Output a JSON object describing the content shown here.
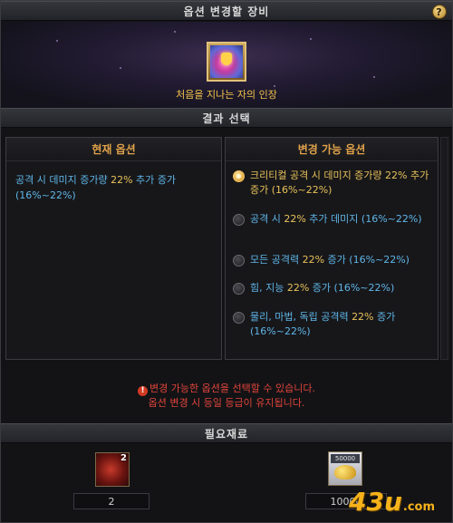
{
  "window": {
    "title": "옵션 변경할 장비",
    "help_label": "?"
  },
  "equipment": {
    "icon": "ring-equipment-icon",
    "name": "처음을 지나는 자의 인장"
  },
  "result_section": {
    "title": "결과 선택"
  },
  "current_option": {
    "title": "현재 옵션",
    "text_before": "공격 시 데미지 증가량 ",
    "highlight": "22%",
    "text_after": " 추가 증가 (16%~22%)"
  },
  "changeable_options": {
    "title": "변경 가능 옵션",
    "items": [
      {
        "before": "크리티컬 공격 시 데미지 증가량 ",
        "highlight": "22%",
        "after": " 추가 증가 (16%~22%)",
        "selected": true
      },
      {
        "before": "공격 시 ",
        "highlight": "22%",
        "after": " 추가 데미지 (16%~22%)",
        "selected": false
      },
      {
        "before": "모든 공격력 ",
        "highlight": "22%",
        "after": " 증가 (16%~22%)",
        "selected": false
      },
      {
        "before": "힘, 지능 ",
        "highlight": "22%",
        "after": " 증가 (16%~22%)",
        "selected": false
      },
      {
        "before": "물리, 마법, 독립 공격력 ",
        "highlight": "22%",
        "after": " 증가 (16%~22%)",
        "selected": false
      }
    ]
  },
  "notice": {
    "line1": "변경 가능한 옵션을 선택할 수 있습니다.",
    "line2": "옵션 변경 시 등일 등급이 유지됩니다."
  },
  "materials": {
    "title": "필요재료",
    "item1": {
      "icon": "red-stone-material-icon",
      "badge": "2",
      "value": "2"
    },
    "item2": {
      "icon": "gold-coins-icon",
      "badge": "50000",
      "value": "10000"
    }
  },
  "watermark": {
    "big": "43u",
    "small": ".com"
  },
  "colors": {
    "accent_gold": "#e9c25a",
    "option_blue": "#5fb6e8",
    "notice_red": "#e0443a",
    "panel_title": "#e0a24a"
  }
}
